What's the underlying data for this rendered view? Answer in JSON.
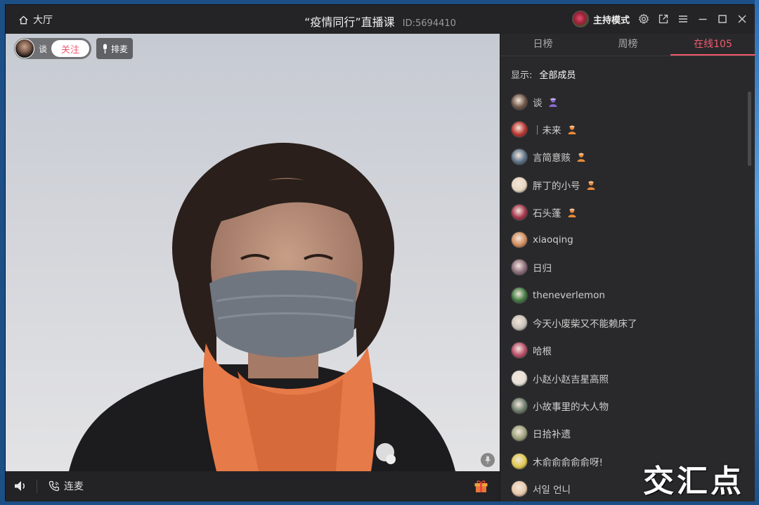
{
  "titlebar": {
    "home_label": "大厅",
    "title": "“疫情同行”直播课",
    "room_id": "ID:5694410",
    "host_mode_label": "主持模式",
    "icons": [
      "settings-icon",
      "popout-icon",
      "menu-icon",
      "minimize-icon",
      "maximize-icon",
      "close-icon"
    ]
  },
  "video": {
    "anchor_name": "谈",
    "follow_label": "关注",
    "queue_label": "排麦"
  },
  "bottombar": {
    "lianmai_label": "连麦"
  },
  "panel": {
    "tabs": [
      "日榜",
      "周榜",
      "在线105"
    ],
    "active_tab": 2,
    "show_label": "显示:",
    "show_value": "全部成员",
    "members": [
      {
        "name": "谈",
        "badge": "host",
        "avatar": "#6e5445"
      },
      {
        "name": "｜未来",
        "badge": "admin",
        "avatar": "#b8322c"
      },
      {
        "name": "言简意赅",
        "badge": "admin",
        "avatar": "#5a6f87"
      },
      {
        "name": "胖丁的小号",
        "badge": "admin",
        "avatar": "#e8d6c0"
      },
      {
        "name": "石头蓬",
        "badge": "admin",
        "avatar": "#a4324a"
      },
      {
        "name": "xiaoqing",
        "badge": "",
        "avatar": "#d08a5a"
      },
      {
        "name": "日归",
        "badge": "",
        "avatar": "#8a6a78"
      },
      {
        "name": "theneverlemon",
        "badge": "",
        "avatar": "#3f7a3f"
      },
      {
        "name": "今天小废柴又不能赖床了",
        "badge": "",
        "avatar": "#c8c0b8"
      },
      {
        "name": "哈根",
        "badge": "",
        "avatar": "#b84a66"
      },
      {
        "name": "小赵小赵吉星高照",
        "badge": "",
        "avatar": "#e6e0d8"
      },
      {
        "name": "小故事里的大人物",
        "badge": "",
        "avatar": "#6a7a6a"
      },
      {
        "name": "日拾补遗",
        "badge": "",
        "avatar": "#9aa07a"
      },
      {
        "name": "木俞俞俞俞俞呀!",
        "badge": "",
        "avatar": "#e0c84a"
      },
      {
        "name": "서일 언니",
        "badge": "",
        "avatar": "#e8c8a8"
      }
    ]
  },
  "watermark": "交汇点",
  "colors": {
    "accent": "#f05a6e",
    "window_bg": "#2b2b2d",
    "titlebar_bg": "#242426",
    "host_badge": "#8a6ad8",
    "admin_badge": "#e88a3a"
  }
}
